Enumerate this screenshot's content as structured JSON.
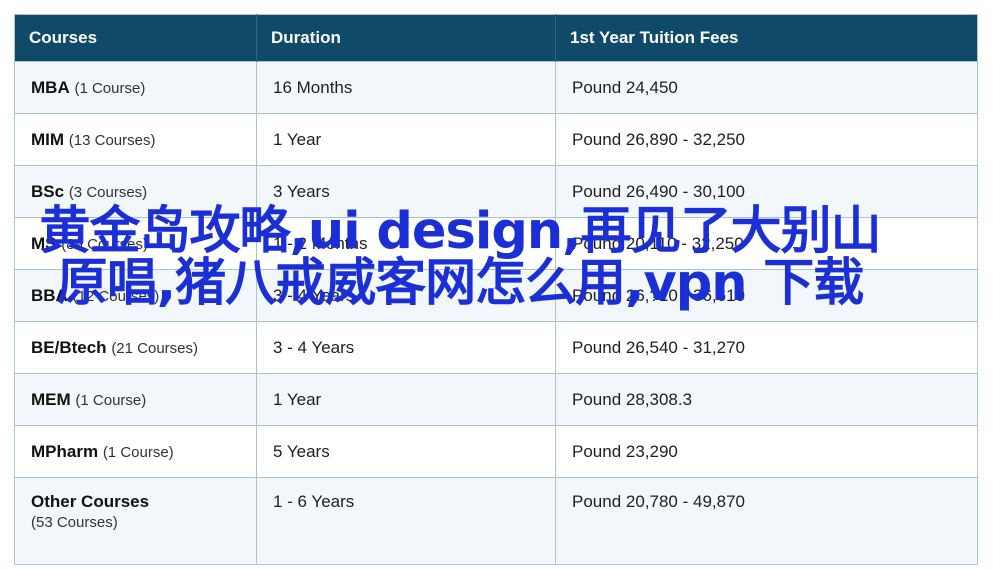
{
  "table": {
    "headers": [
      "Courses",
      "Duration",
      "1st Year Tuition Fees"
    ],
    "rows": [
      {
        "course": "MBA",
        "count": "(1 Course)",
        "duration": "16 Months",
        "fees": "Pound 24,450"
      },
      {
        "course": "MIM",
        "count": "(13 Courses)",
        "duration": "1 Year",
        "fees": "Pound 26,890 - 32,250"
      },
      {
        "course": "BSc",
        "count": "(3 Courses)",
        "duration": "3 Years",
        "fees": "Pound 26,490 - 30,100"
      },
      {
        "course": "MS",
        "count": "(89 Courses)",
        "duration": "1 - 2 Months",
        "fees": "Pound 20,110 - 32,250"
      },
      {
        "course": "BBA",
        "count": "(12 Courses)",
        "duration": "3 - 4 Years",
        "fees": "Pound 26,?10 - 36,610"
      },
      {
        "course": "BE/Btech",
        "count": "(21 Courses)",
        "duration": "3 - 4 Years",
        "fees": "Pound 26,540 - 31,270"
      },
      {
        "course": "MEM",
        "count": "(1 Course)",
        "duration": "1 Year",
        "fees": "Pound 28,308.3"
      },
      {
        "course": "MPharm",
        "count": "(1 Course)",
        "duration": "5 Years",
        "fees": "Pound 23,290"
      },
      {
        "course": "Other Courses",
        "count": "(53 Courses)",
        "duration": "1 - 6 Years",
        "fees": "Pound 20,780 - 49,870"
      }
    ]
  },
  "overlay_text": "黄金岛攻略,ui design,再见了大别山原唱,猪八戒威客网怎么用,vpn 下载"
}
